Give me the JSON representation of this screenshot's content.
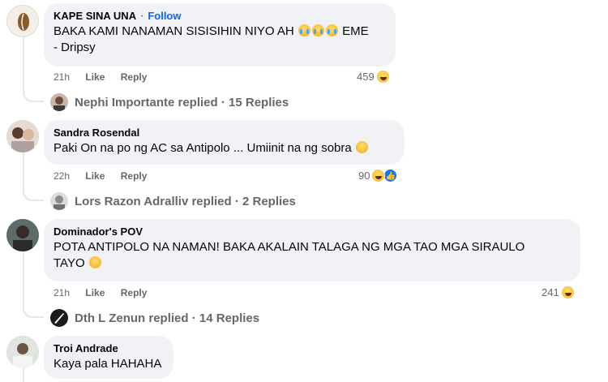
{
  "comments": [
    {
      "author": "KAPE SINA UNA",
      "follow": "Follow",
      "text_before": "BAKA KAMI NANAMAN SISISIHIN NIYO AH ",
      "text_after": " EME",
      "text_line2": "- Dripsy",
      "time": "21h",
      "like": "Like",
      "reply": "Reply",
      "reaction_count": "459",
      "reply_summary": "Nephi Importante replied · 15 Replies"
    },
    {
      "author": "Sandra Rosendal",
      "text": "Paki On na po ng AC sa Antipolo ... Umiinit na ng sobra",
      "time": "22h",
      "like": "Like",
      "reply": "Reply",
      "reaction_count": "90",
      "reply_summary": "Lors Razon Adralliv replied · 2 Replies"
    },
    {
      "author": "Dominador's POV",
      "text_line1": "POTA ANTIPOLO NA NAMAN! BAKA AKALAIN TALAGA NG MGA TAO MGA SIRAULO",
      "text_line2": "TAYO",
      "time": "21h",
      "like": "Like",
      "reply": "Reply",
      "reaction_count": "241",
      "reply_summary": "Dth L Zenun replied · 14 Replies"
    },
    {
      "author": "Troi Andrade",
      "text": "Kaya pala HAHAHA"
    }
  ],
  "colors": {
    "bubble": "#f0f2f5",
    "meta": "#65676b",
    "follow": "#0866ff"
  }
}
